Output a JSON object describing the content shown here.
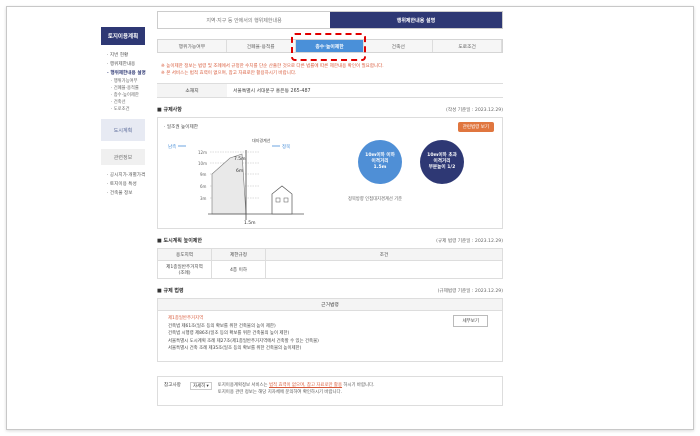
{
  "sidebar": {
    "title": "토지이용계획",
    "items": [
      {
        "label": "· 지번 현황"
      },
      {
        "label": "· 행위제한내용"
      },
      {
        "label": "· 행위제한내용 설명"
      }
    ],
    "subitems": [
      {
        "label": "· 행위가능여부"
      },
      {
        "label": "· 건폐율·용적률"
      },
      {
        "label": "· 층수·높이제한"
      },
      {
        "label": "· 건축선"
      },
      {
        "label": "· 도로조건"
      }
    ],
    "block1": "도시계획",
    "block2": "관련정보",
    "links": [
      {
        "label": "· 공시지가·개별가격"
      },
      {
        "label": "· 토지이용 특성"
      },
      {
        "label": "· 건축물 정보"
      }
    ]
  },
  "top_tabs": [
    {
      "label": "지역·지구 등 안에서의 행위제한내용"
    },
    {
      "label": "행위제한내용 설명"
    }
  ],
  "sub_tabs": [
    {
      "label": "행위가능여부"
    },
    {
      "label": "건폐율·용적률"
    },
    {
      "label": "층수·높이제한"
    },
    {
      "label": "건축선"
    },
    {
      "label": "도로조건"
    }
  ],
  "notice": [
    "※ 높이제한 정보는 법령 및 조례에서 규정한 수치를 단순 산출한 것으로 다른 법률에 따른 제한내용 확인이 필요합니다.",
    "※ 본 서비스는 법적 효력이 없으며, 참고 자료로만 활용하시기 바랍니다."
  ],
  "address": {
    "label": "소재지",
    "value": "서울특별시 서대문구 홍은동 265-487"
  },
  "regulation": {
    "title": "■ 규제사항",
    "date": "(작성 기준일 : 2023.12.29)",
    "subtitle": "· 일조권 높이제한",
    "button": "관련법령 보기",
    "diagram": {
      "north": "정북",
      "south": "남측",
      "boundary": "대지경계선",
      "heights": [
        "12m",
        "10m",
        "9m",
        "6m",
        "3m"
      ],
      "dims": [
        "7.5m",
        "6m"
      ],
      "setback": "1.5m"
    },
    "circle1": [
      "10m이하 이하",
      "이격거리",
      "1.5m"
    ],
    "circle2": [
      "10m이하 초과",
      "이격거리",
      "부분높이 1/2"
    ],
    "note": "정북방향 인접대지경계선 기준"
  },
  "urban": {
    "title": "■ 도시계획 높이제한",
    "date": "(규제 법령 기준일 : 2023.12.29)",
    "headers": [
      "용도지역",
      "제한규정",
      "조건"
    ],
    "row": {
      "zone": "제1종일반주거지역",
      "zone2": "(조례)",
      "rule": "4층 이하",
      "cond": ""
    }
  },
  "basis": {
    "title": "■ 규제 법령",
    "date": "(규제법령 기준일 : 2023.12.29)",
    "head": "근거법령",
    "lines": [
      "제1종일반주거지역",
      "건축법 제61조(일조 등의 확보를 위한 건축물의 높이 제한)",
      "건축법 시행령 제86조(일조 등의 확보를 위한 건축물의 높이 제한)",
      "서울특별시 도시계획 조례 제27조(제1종일반주거지역에서 건축할 수 있는 건축물)",
      "서울특별시 건축 조례 제35조(일조 등의 확보를 위한 건축물의 높이제한)"
    ],
    "detail_button": "세부보기"
  },
  "footer": {
    "label": "참고사항",
    "select": "자세히 ▾",
    "text1": "토지이용계획정보 서비스는",
    "link": "법적 효력이 없으며, 참고 자료로만 활용",
    "text1b": "하시기 바랍니다.",
    "text2": "토지이용 관련 정보는 해당 지자체에 문의하여 확인하시기 바랍니다."
  },
  "colors": {
    "navy": "#2e3874",
    "blue": "#4a90d9",
    "orange": "#e0763f",
    "red": "#e00000"
  }
}
